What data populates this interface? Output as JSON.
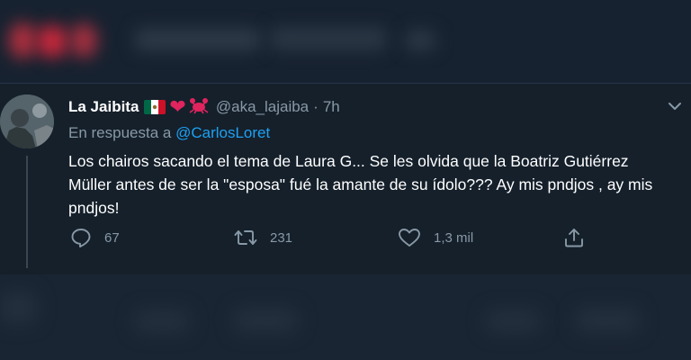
{
  "tweet": {
    "name": "La Jaibita",
    "handle": "@aka_lajaiba",
    "separator": "·",
    "time": "7h",
    "reply_prefix": "En respuesta a",
    "reply_mention": "@CarlosLoret",
    "text": "Los chairos sacando el tema de Laura G... Se les olvida que la Boatriz Gutiérrez Müller antes de ser la \"esposa\" fué la amante de su ídolo???  Ay mis pndjos , ay mis pndjos!",
    "emoji": {
      "flag": "mexico-flag-icon",
      "heart": "❤",
      "crab": "🦀"
    }
  },
  "actions": {
    "reply_count": "67",
    "retweet_count": "231",
    "like_count": "1,3 mil"
  },
  "colors": {
    "background": "#15202b",
    "text": "#ffffff",
    "muted": "#8899a6",
    "link": "#1da1f2",
    "heart": "#e0245e"
  }
}
